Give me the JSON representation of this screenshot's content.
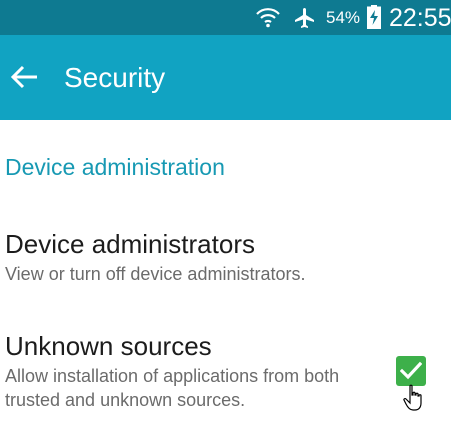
{
  "status_bar": {
    "wifi_icon": "wifi-icon",
    "airplane_icon": "airplane-mode-icon",
    "battery_percent": "54%",
    "battery_icon": "battery-charging-icon",
    "time": "22:55"
  },
  "app_bar": {
    "back_icon": "back-arrow-icon",
    "title": "Security"
  },
  "sections": {
    "device_admin": {
      "header": "Device administration",
      "items": [
        {
          "title": "Device administrators",
          "summary": "View or turn off device administrators."
        },
        {
          "title": "Unknown sources",
          "summary": "Allow installation of applications from both trusted and unknown sources.",
          "checked": true
        }
      ]
    }
  },
  "colors": {
    "status_bar_bg": "#0e7a91",
    "app_bar_bg": "#11a3c2",
    "accent": "#1799b3",
    "checkbox": "#3db04a"
  }
}
